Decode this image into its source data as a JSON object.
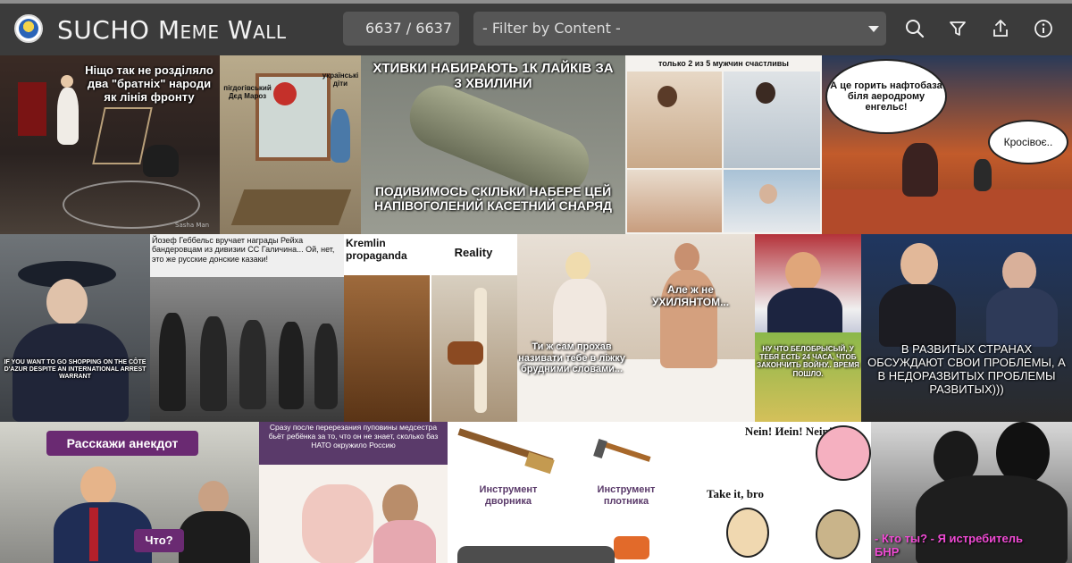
{
  "header": {
    "title": "SUCHO Meme Wall",
    "counter": "6637 / 6637",
    "filter_placeholder": "- Filter by Content -"
  },
  "icons": {
    "logo": "sucho-logo",
    "search": "search-icon",
    "filter": "filter-icon",
    "share": "share-icon",
    "info": "info-icon"
  },
  "colors": {
    "header_bg": "#3b3b3b",
    "control_bg": "#565656",
    "page_bg": "#2b2b2b"
  },
  "memes": [
    {
      "caption": "Ніщо так не розділяло два \"братніх\" народи як лінія фронту",
      "credit": "Sasha Man"
    },
    {
      "caption_left": "пігдогівський Дєд Мароз",
      "caption_right": "українські діти"
    },
    {
      "caption_top": "ХТИВКИ НАБИРАЮТЬ 1К ЛАЙКІВ ЗА 3 ХВИЛИНИ",
      "caption_bottom": "ПОДИВИМОСЬ СКІЛЬКИ НАБЕРЕ ЦЕЙ НАПІВОГОЛЕНИЙ КАСЕТНИЙ СНАРЯД"
    },
    {
      "caption": "только 2 из 5 мужчин счастливы"
    },
    {
      "bubble_1": "А це горить нафтобаза біля аеродрому енгельс!",
      "bubble_2": "Кросівоє.."
    },
    {
      "caption": "IF YOU WANT TO GO SHOPPING ON THE CÔTE D'AZUR DESPITE AN INTERNATIONAL ARREST WARRANT"
    },
    {
      "caption": "Йозеф Геббельс вручает награды Рейха бандеровцам из дивизии СС Галичина... Ой, нет, это же русские донские казаки!"
    },
    {
      "label_left": "Kremlin propaganda",
      "label_right": "Reality"
    },
    {
      "bubble": "Але ж не УХИЛЯНТОМ...",
      "caption": "Ти ж сам прохав називати тебе в ліжку брудними словами..."
    },
    {
      "caption": "НУ ЧТО БЕЛОБРЫСЫЙ, У ТЕБЯ ЕСТЬ 24 ЧАСА, ЧТОБ ЗАКОНЧИТЬ ВОЙНУ.. ВРЕМЯ ПОШЛО."
    },
    {
      "caption": "В РАЗВИТЫХ СТРАНАХ ОБСУЖДАЮТ СВОИ ПРОБЛЕМЫ, А В НЕДОРАЗВИТЫХ ПРОБЛЕМЫ РАЗВИТЫХ)))"
    },
    {
      "bubble_1": "Расскажи анекдот",
      "bubble_2": "Что?"
    },
    {
      "caption": "Сразу после перерезания пуповины медсестра бьёт ребёнка за то, что он не знает, сколько баз НАТО окружило Россию"
    },
    {
      "label_left": "Инструмент дворника",
      "label_right": "Инструмент плотника"
    },
    {
      "text_1": "Nein! Иеin! Nein!",
      "text_2": "Take it, bro"
    },
    {
      "caption": "- Кто ты? - Я истребитель БНР"
    }
  ]
}
